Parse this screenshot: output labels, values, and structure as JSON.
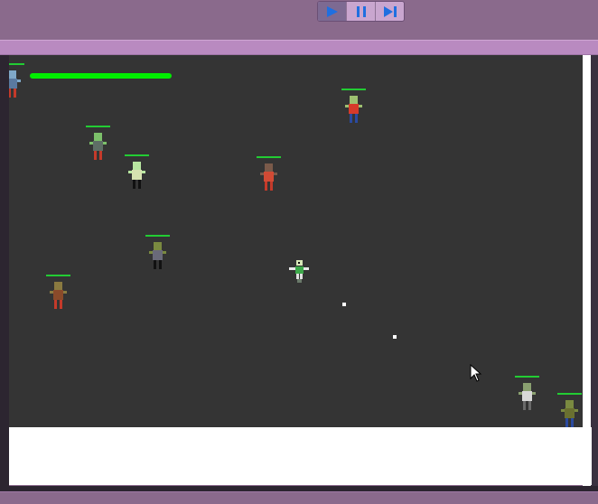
{
  "controls": {
    "play_icon": "play-icon",
    "pause_icon": "pause-icon",
    "step_icon": "step-icon",
    "active": "play"
  },
  "colors": {
    "frame": "#8a6a8c",
    "stripe": "#b98ac0",
    "game_bg": "#343434",
    "health": "#00ee00",
    "zombie_health": "#22cc33",
    "toolbar_icon": "#1f6fe0"
  },
  "player": {
    "health": 1.0
  },
  "zombies": [
    {
      "id": "z1",
      "skin": "#7cc06a",
      "shirt": "#5e6e66",
      "pants": "#c43a2a"
    },
    {
      "id": "z2",
      "skin": "#b8e6a0",
      "shirt": "#d6e2b0",
      "pants": "#111111"
    },
    {
      "id": "z3",
      "skin": "#7a5a4a",
      "shirt": "#d24a34",
      "pants": "#c43a2a"
    },
    {
      "id": "z4",
      "skin": "#9ec070",
      "shirt": "#d63a2a",
      "pants": "#2a4aa0"
    },
    {
      "id": "z5",
      "skin": "#7a8a40",
      "shirt": "#6a6a7a",
      "pants": "#111111"
    },
    {
      "id": "z6",
      "skin": "#8a7a40",
      "shirt": "#8a4a2a",
      "pants": "#c43a2a"
    },
    {
      "id": "z7",
      "skin": "#8aa070",
      "shirt": "#d8d8d8",
      "pants": "#6a6a6a"
    },
    {
      "id": "z8",
      "skin": "#7a8a40",
      "shirt": "#6a7030",
      "pants": "#2a4aa0"
    },
    {
      "id": "z9",
      "skin": "#7fa8c8",
      "shirt": "#5a7aa0",
      "pants": "#c43a2a"
    }
  ]
}
